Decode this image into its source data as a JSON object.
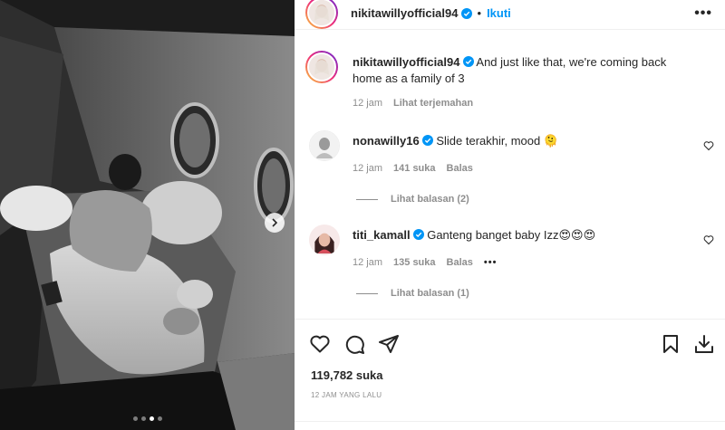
{
  "post": {
    "username": "nikitawillyofficial94",
    "follow_label": "Ikuti",
    "more_label": "•••"
  },
  "caption": {
    "username": "nikitawillyofficial94",
    "text": "And just like that, we're coming back home as a family of 3",
    "time": "12 jam",
    "translate_label": "Lihat terjemahan"
  },
  "comments": [
    {
      "username": "nonawilly16",
      "text": "Slide terakhir, mood 🫠",
      "time": "12 jam",
      "likes": "141 suka",
      "reply_label": "Balas",
      "view_replies": "Lihat balasan (2)"
    },
    {
      "username": "titi_kamall",
      "text": "Ganteng banget baby Izz😍😍😍",
      "time": "12 jam",
      "likes": "135 suka",
      "reply_label": "Balas",
      "options_label": "•••",
      "view_replies": "Lihat balasan (1)"
    }
  ],
  "engagement": {
    "likes": "119,782 suka",
    "timestamp": "12 JAM YANG LALU"
  },
  "carousel": {
    "total_slides": 4,
    "active_slide": 3
  },
  "colors": {
    "accent": "#0095f6",
    "text": "#262626",
    "muted": "#8e8e8e",
    "verified": "#0095f6"
  }
}
